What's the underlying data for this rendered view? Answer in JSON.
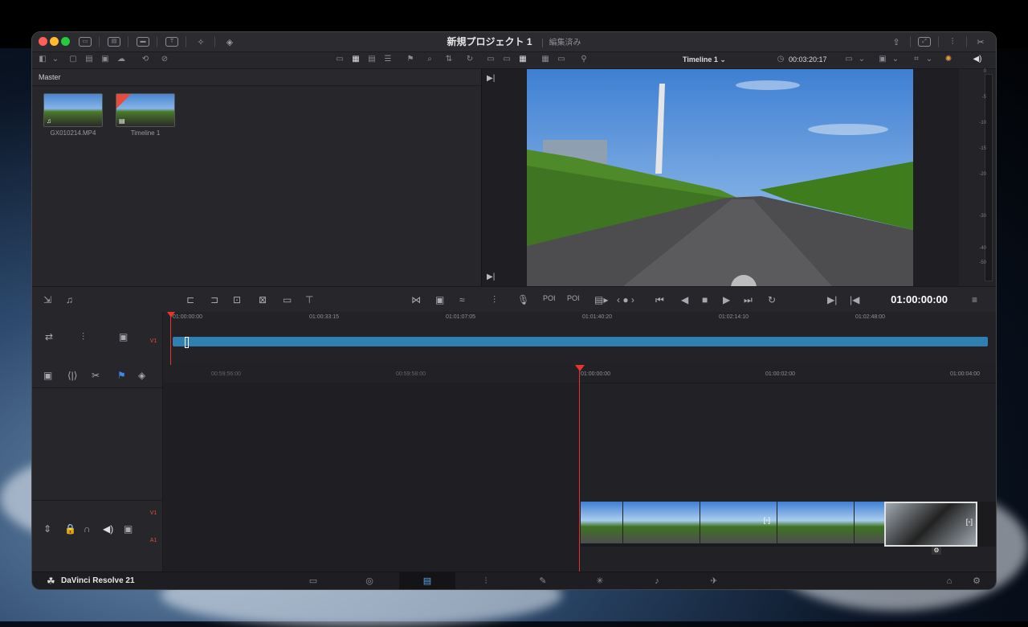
{
  "window": {
    "project_title": "新規プロジェクト 1",
    "project_status": "編集済み",
    "traffic_lights": {
      "close": "#fe5f57",
      "minimize": "#febc2e",
      "zoom": "#28c840"
    }
  },
  "toolbar": {
    "timeline_selector": "Timeline 1",
    "duration_timecode": "00:03:20:17"
  },
  "media_pool": {
    "bin_label": "Master",
    "clips": [
      {
        "name": "GX010214.MP4",
        "type": "audio-video"
      },
      {
        "name": "Timeline 1",
        "type": "timeline"
      }
    ]
  },
  "viewer": {
    "timecode": "01:00:00:00"
  },
  "audio_meter": {
    "scale": [
      "0",
      "-5",
      "-10",
      "-15",
      "-20",
      "-30",
      "-40",
      "-50"
    ]
  },
  "mini_timeline": {
    "track_label": "V1",
    "ruler": [
      "01:00:00:00",
      "01:00:33:15",
      "01:01:07:05",
      "01:01:40:20",
      "01:02:14:10",
      "01:02:48:00"
    ]
  },
  "timeline": {
    "ruler": [
      "00:59:56:00",
      "00:59:58:00",
      "01:00:00:00",
      "01:00:02:00",
      "01:00:04:00"
    ],
    "video_track_label": "V1",
    "audio_track_label": "A1"
  },
  "footer": {
    "app_name": "DaVinci Resolve 21",
    "pages": [
      "media",
      "cut",
      "edit",
      "fusion",
      "color",
      "fairlight",
      "deliver"
    ]
  },
  "colors": {
    "accent": "#e64b3c",
    "clip_blue": "#2f7fb0",
    "playhead": "#e8342c"
  }
}
